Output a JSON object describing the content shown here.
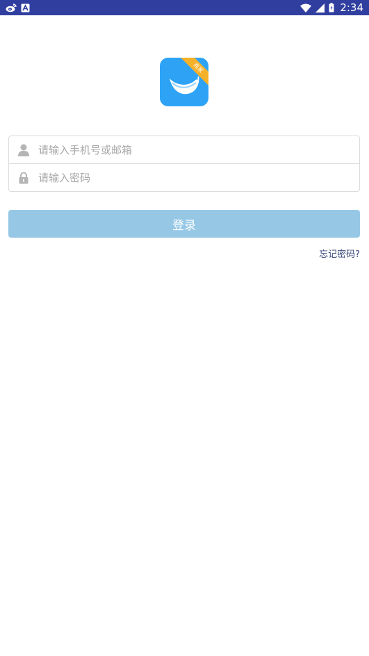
{
  "status_bar": {
    "time": "2:34",
    "left_icons": [
      "weibo-icon",
      "app-notification-icon"
    ],
    "right_icons": [
      "wifi-icon",
      "signal-icon",
      "battery-icon"
    ]
  },
  "logo": {
    "ribbon_text": "商家",
    "colors": {
      "background": "#2ea3f6",
      "ribbon": "#f6b12a"
    }
  },
  "form": {
    "account_placeholder": "请输入手机号或邮箱",
    "password_placeholder": "请输入密码",
    "account_icon": "user-icon",
    "password_icon": "lock-icon"
  },
  "login_button": {
    "label": "登录",
    "color": "#96c8e6"
  },
  "forgot_password": {
    "label": "忘记密码?"
  },
  "colors": {
    "status_bar": "#303f9f",
    "background": "#ffffff"
  }
}
